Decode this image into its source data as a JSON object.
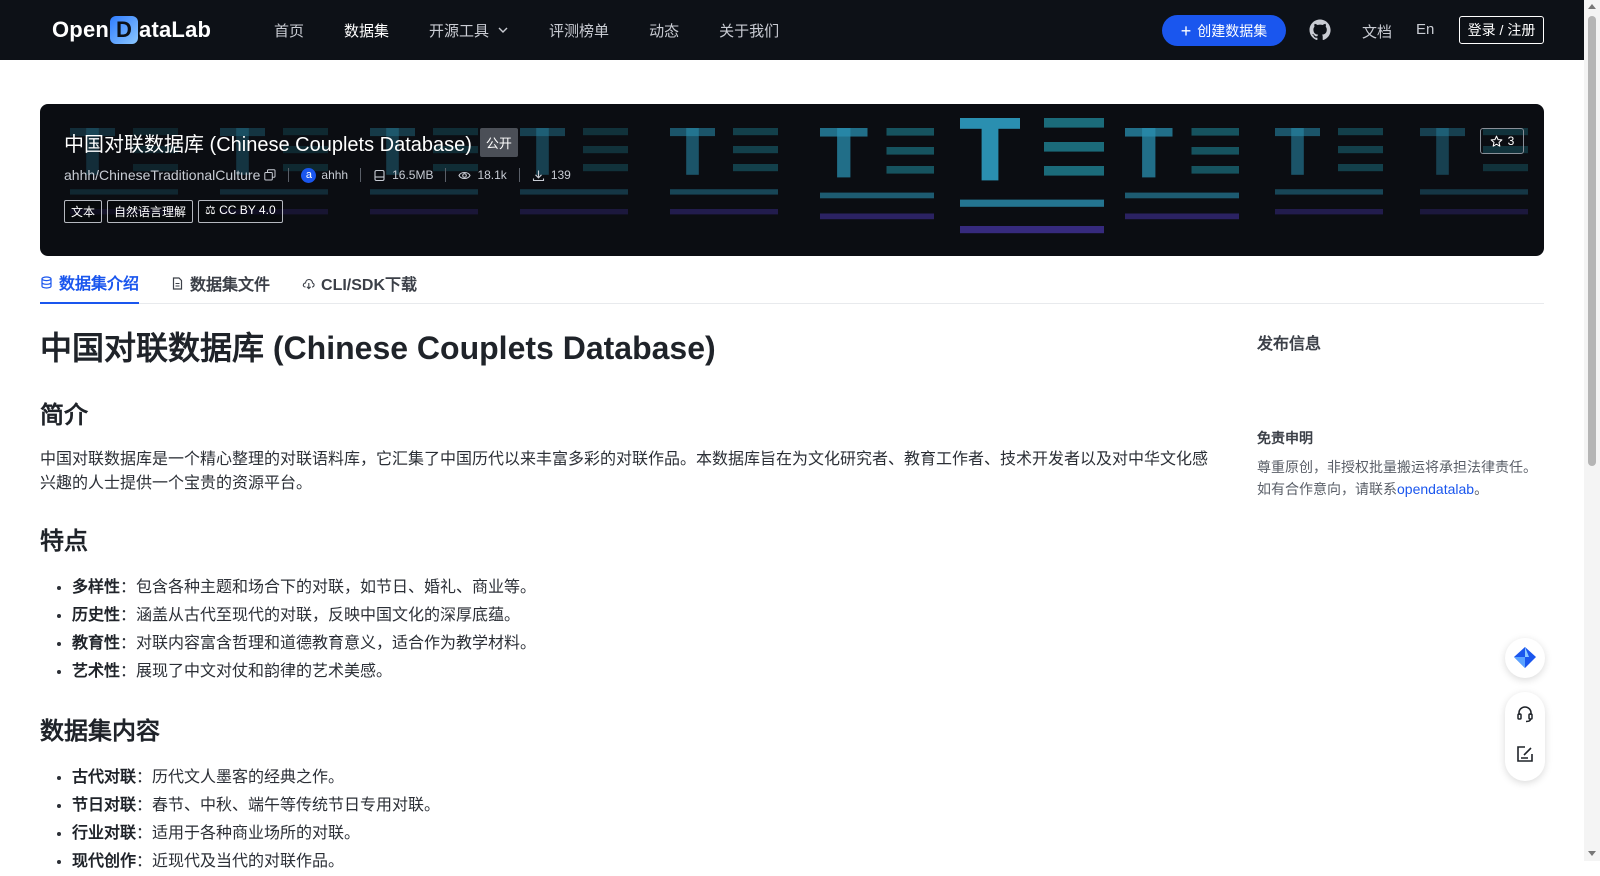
{
  "nav": {
    "logo": {
      "prefix": "Open",
      "mark": "D",
      "suffix": "ataLab"
    },
    "links": [
      {
        "label": "首页",
        "active": false
      },
      {
        "label": "数据集",
        "active": true
      },
      {
        "label": "开源工具",
        "active": false,
        "dropdown": true
      },
      {
        "label": "评测榜单",
        "active": false
      },
      {
        "label": "动态",
        "active": false
      },
      {
        "label": "关于我们",
        "active": false
      }
    ],
    "create_label": "创建数据集",
    "docs_label": "文档",
    "lang_label": "En",
    "login_label": "登录 / 注册"
  },
  "banner": {
    "title": "中国对联数据库 (Chinese Couplets Database)",
    "visibility": "公开",
    "repo": "ahhh/ChineseTraditionalCulture",
    "avatar_letter": "a",
    "owner": "ahhh",
    "size": "16.5MB",
    "views": "18.1k",
    "downloads": "139",
    "tags": [
      "文本",
      "自然语言理解"
    ],
    "license": "CC BY 4.0",
    "stars": "3"
  },
  "tabs": [
    {
      "label": "数据集介绍",
      "active": true,
      "icon": "database-icon"
    },
    {
      "label": "数据集文件",
      "active": false,
      "icon": "file-icon"
    },
    {
      "label": "CLI/SDK下载",
      "active": false,
      "icon": "cloud-download-icon"
    }
  ],
  "content": {
    "title": "中国对联数据库 (Chinese Couplets Database)",
    "intro_heading": "简介",
    "intro_text": "中国对联数据库是一个精心整理的对联语料库，它汇集了中国历代以来丰富多彩的对联作品。本数据库旨在为文化研究者、教育工作者、技术开发者以及对中华文化感兴趣的人士提供一个宝贵的资源平台。",
    "features_heading": "特点",
    "features": [
      {
        "term": "多样性",
        "desc": "：包含各种主题和场合下的对联，如节日、婚礼、商业等。"
      },
      {
        "term": "历史性",
        "desc": "：涵盖从古代至现代的对联，反映中国文化的深厚底蕴。"
      },
      {
        "term": "教育性",
        "desc": "：对联内容富含哲理和道德教育意义，适合作为教学材料。"
      },
      {
        "term": "艺术性",
        "desc": "：展现了中文对仗和韵律的艺术美感。"
      }
    ],
    "contents_heading": "数据集内容",
    "contents": [
      {
        "term": "古代对联",
        "desc": "：历代文人墨客的经典之作。"
      },
      {
        "term": "节日对联",
        "desc": "：春节、中秋、端午等传统节日专用对联。"
      },
      {
        "term": "行业对联",
        "desc": "：适用于各种商业场所的对联。"
      },
      {
        "term": "现代创作",
        "desc": "：近现代及当代的对联作品。"
      }
    ]
  },
  "sidebar": {
    "publish_title": "发布信息",
    "disclaimer_title": "免责申明",
    "disclaimer_line1": "尊重原创，非授权批量搬运将承担法律责任。",
    "disclaimer_line2_pre": "如有合作意向，请联系",
    "disclaimer_link": "opendatalab",
    "disclaimer_line2_post": "。"
  },
  "colors": {
    "nav_bg": "#0d1117",
    "accent": "#1a56ee",
    "banner_bg": "#0b0d12",
    "deco_teal": "#1b6b7a",
    "deco_blue": "#2a8fb0",
    "deco_purple": "#3b2d8a"
  }
}
